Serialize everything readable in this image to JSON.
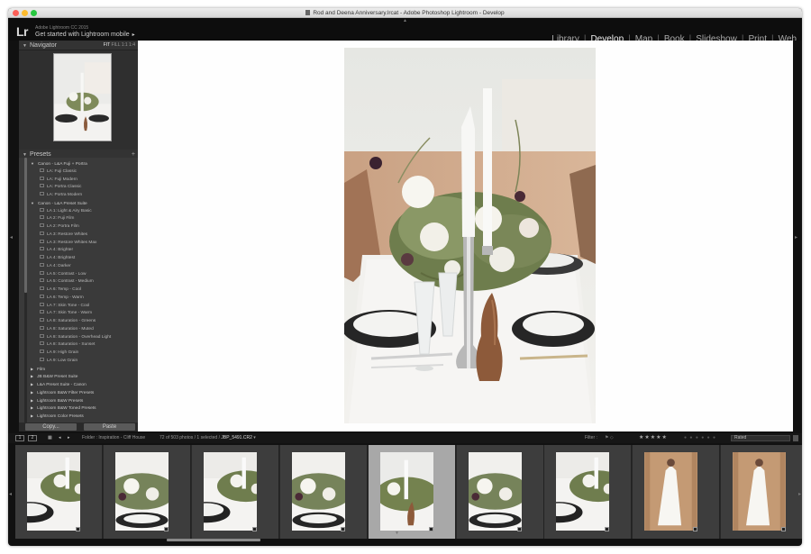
{
  "window": {
    "document_title": "Rod and Deena Anniversary.lrcat - Adobe Photoshop Lightroom - Develop"
  },
  "identity": {
    "logo": "Lr",
    "product": "Adobe Lightroom CC 2015",
    "mobile_label": "Get started with Lightroom mobile"
  },
  "modules": [
    {
      "label": "Library",
      "active": false
    },
    {
      "label": "Develop",
      "active": true
    },
    {
      "label": "Map",
      "active": false
    },
    {
      "label": "Book",
      "active": false
    },
    {
      "label": "Slideshow",
      "active": false
    },
    {
      "label": "Print",
      "active": false
    },
    {
      "label": "Web",
      "active": false
    }
  ],
  "navigator": {
    "title": "Navigator",
    "zoom": [
      "FIT",
      "FILL",
      "1:1",
      "1:4"
    ]
  },
  "presets": {
    "title": "Presets",
    "add_label": "+",
    "rows": [
      {
        "type": "folder",
        "open": true,
        "label": "Canon - L&A Fuji + Portra"
      },
      {
        "type": "item",
        "label": "LA: Fuji Classic"
      },
      {
        "type": "item",
        "label": "LA: Fuji Modern"
      },
      {
        "type": "item",
        "label": "LA: Portra Classic"
      },
      {
        "type": "item",
        "label": "LA: Portra Modern"
      },
      {
        "type": "folder",
        "open": true,
        "label": "Canon - L&A Preset Suite"
      },
      {
        "type": "item",
        "label": "LA 1: Light & Airy Basic"
      },
      {
        "type": "item",
        "label": "LA 2: Fuji Film"
      },
      {
        "type": "item",
        "label": "LA 2: Portra Film"
      },
      {
        "type": "item",
        "label": "LA 3: Restore Whites"
      },
      {
        "type": "item",
        "label": "LA 3: Restore Whites Max"
      },
      {
        "type": "item",
        "label": "LA 4: Brighter"
      },
      {
        "type": "item",
        "label": "LA 4: Brightest"
      },
      {
        "type": "item",
        "label": "LA 4: Darker"
      },
      {
        "type": "item",
        "label": "LA 5: Contrast - Low"
      },
      {
        "type": "item",
        "label": "LA 5: Contrast - Medium"
      },
      {
        "type": "item",
        "label": "LA 6: Temp - Cool"
      },
      {
        "type": "item",
        "label": "LA 6: Temp - Warm"
      },
      {
        "type": "item",
        "label": "LA 7: Skin Tone - Cool"
      },
      {
        "type": "item",
        "label": "LA 7: Skin Tone - Warm"
      },
      {
        "type": "item",
        "label": "LA 8: Saturation - Greens"
      },
      {
        "type": "item",
        "label": "LA 8: Saturation - Muted"
      },
      {
        "type": "item",
        "label": "LA 8: Saturation - Overhead Light"
      },
      {
        "type": "item",
        "label": "LA 8: Saturation - Sunset"
      },
      {
        "type": "item",
        "label": "LA 9: High Grain"
      },
      {
        "type": "item",
        "label": "LA 9: Low Grain"
      },
      {
        "type": "folder",
        "open": false,
        "label": "Film"
      },
      {
        "type": "folder",
        "open": false,
        "label": "JB B&W Preset Suite"
      },
      {
        "type": "folder",
        "open": false,
        "label": "L&A Preset Suite - Canon"
      },
      {
        "type": "folder",
        "open": false,
        "label": "Lightroom B&W Filter Presets"
      },
      {
        "type": "folder",
        "open": false,
        "label": "Lightroom B&W Presets"
      },
      {
        "type": "folder",
        "open": false,
        "label": "Lightroom B&W Toned Presets"
      },
      {
        "type": "folder",
        "open": false,
        "label": "Lightroom Color Presets"
      }
    ]
  },
  "buttons": {
    "copy": "Copy...",
    "paste": "Paste"
  },
  "filmstrip_toolbar": {
    "monitor1": "1",
    "monitor2": "2",
    "path": "Folder : Inspiration - Cliff House",
    "count": "72 of 503 photos / 1 selected /",
    "file": "JBP_5491.CR2",
    "filter_label": "Filter :",
    "stars": "★★★★★",
    "filter_select": "Rated"
  },
  "filmstrip": {
    "cells": [
      {
        "type": "table",
        "orientation": "land"
      },
      {
        "type": "flowers",
        "orientation": "land"
      },
      {
        "type": "table",
        "orientation": "land"
      },
      {
        "type": "flowers",
        "orientation": "land"
      },
      {
        "type": "centerpiece",
        "orientation": "portrait",
        "selected": true
      },
      {
        "type": "flowers",
        "orientation": "land"
      },
      {
        "type": "table",
        "orientation": "land"
      },
      {
        "type": "dress",
        "orientation": "portrait"
      },
      {
        "type": "dress",
        "orientation": "portrait"
      }
    ]
  },
  "colors": {
    "panel": "#3a3a3a",
    "panel_header": "#333333",
    "module_active": "#f0f0f0",
    "module_inactive": "#aaaaaa",
    "selected_cell": "#a8a8a8"
  }
}
